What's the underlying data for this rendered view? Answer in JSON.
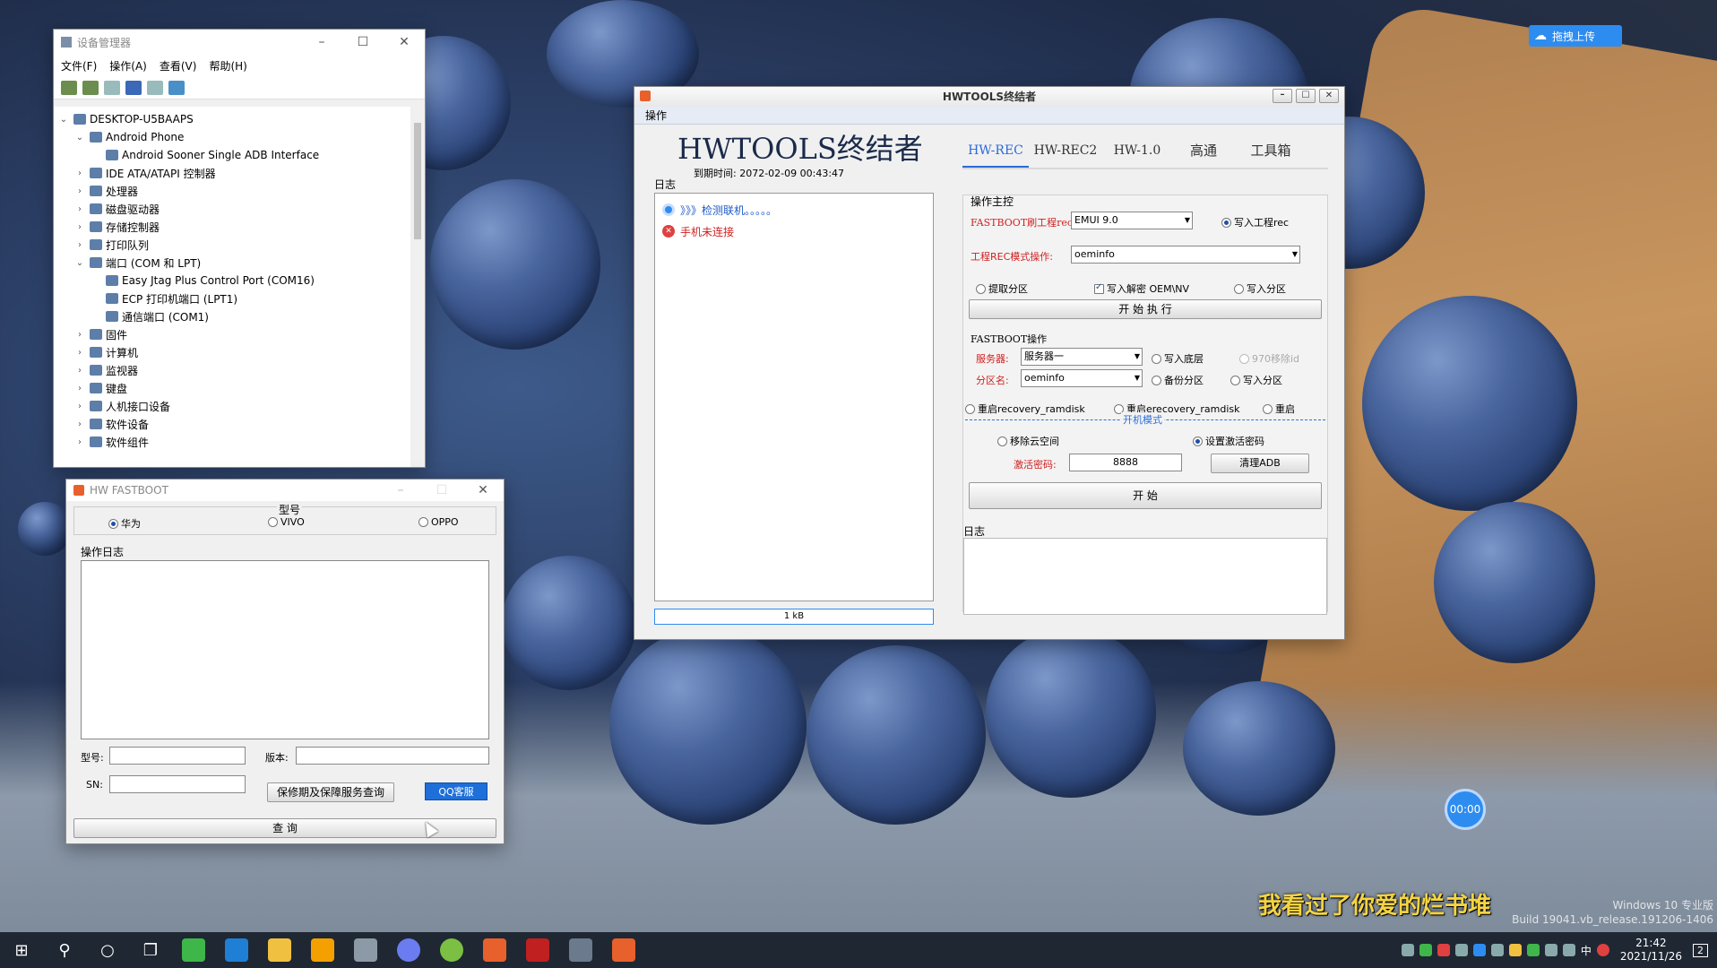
{
  "device_manager": {
    "title": "设备管理器",
    "menu": [
      "文件(F)",
      "操作(A)",
      "查看(V)",
      "帮助(H)"
    ],
    "tree": [
      {
        "label": "DESKTOP-U5BAAPS",
        "level": 0,
        "expanded": true
      },
      {
        "label": "Android Phone",
        "level": 1,
        "expanded": true
      },
      {
        "label": "Android Sooner Single ADB Interface",
        "level": 2
      },
      {
        "label": "IDE ATA/ATAPI 控制器",
        "level": 1
      },
      {
        "label": "处理器",
        "level": 1
      },
      {
        "label": "磁盘驱动器",
        "level": 1
      },
      {
        "label": "存储控制器",
        "level": 1
      },
      {
        "label": "打印队列",
        "level": 1
      },
      {
        "label": "端口 (COM 和 LPT)",
        "level": 1,
        "expanded": true
      },
      {
        "label": "Easy Jtag Plus Control Port (COM16)",
        "level": 2
      },
      {
        "label": "ECP 打印机端口 (LPT1)",
        "level": 2
      },
      {
        "label": "通信端口 (COM1)",
        "level": 2
      },
      {
        "label": "固件",
        "level": 1
      },
      {
        "label": "计算机",
        "level": 1
      },
      {
        "label": "监视器",
        "level": 1
      },
      {
        "label": "键盘",
        "level": 1
      },
      {
        "label": "人机接口设备",
        "level": 1
      },
      {
        "label": "软件设备",
        "level": 1
      },
      {
        "label": "软件组件",
        "level": 1
      }
    ]
  },
  "hw_fastboot": {
    "title": "HW FASTBOOT",
    "model_group": "型号",
    "brands": [
      "华为",
      "VIVO",
      "OPPO"
    ],
    "log_label": "操作日志",
    "model_label": "型号:",
    "version_label": "版本:",
    "sn_label": "SN:",
    "warranty_button": "保修期及保障服务查询",
    "qq_button": "QQ客服",
    "query_button": "查  询"
  },
  "hwtools": {
    "title": "HWTOOLS终结者",
    "menu": "操作",
    "logo": "HWTOOLS终结者",
    "expiry": "到期时间: 2072-02-09 00:43:47",
    "tabs": [
      "HW-REC",
      "HW-REC2",
      "HW-1.0",
      "高通",
      "工具箱"
    ],
    "log_label": "日志",
    "log_entries": [
      {
        "text": "》》》检测联机。。。。。",
        "kind": "info"
      },
      {
        "text": "手机未连接",
        "kind": "error"
      }
    ],
    "progress_text": "1  kB",
    "main_group": "操作主控",
    "fastboot_rec_label": "FASTBOOT刷工程rec:",
    "fastboot_rec_value": "EMUI 9.0",
    "write_rec": "写入工程rec",
    "rec_mode_label": "工程REC模式操作:",
    "rec_mode_value": "oeminfo",
    "extract_partition": "提取分区",
    "write_unlock": "写入解密 OEM\\NV",
    "write_partition": "写入分区",
    "start_execute": "开 始 执 行",
    "fastboot_group": "FASTBOOT操作",
    "server_label": "服务器:",
    "server_value": "服务器一",
    "write_base": "写入底层",
    "remove_970": "970移除id",
    "partition_label": "分区名:",
    "partition_value": "oeminfo",
    "backup_partition": "备份分区",
    "write_partition2": "写入分区",
    "reboot_recovery1": "重启recovery_ramdisk",
    "reboot_recovery2": "重启erecovery_ramdisk",
    "reboot": "重启",
    "boot_mode": "开机模式",
    "remove_cloud": "移除云空间",
    "set_password": "设置激活密码",
    "password_label": "激活密码:",
    "password_value": "8888",
    "clear_adb": "清理ADB",
    "start": "开  始",
    "log2_label": "日志"
  },
  "overlay": {
    "upload_button": "拖拽上传",
    "timer": "00:00",
    "subtitle": "我看过了你爱的烂书堆",
    "watermark_line1": "Windows 10 专业版",
    "watermark_line2": "Build 19041.vb_release.191206-1406"
  },
  "taskbar": {
    "time": "21:42",
    "date": "2021/11/26",
    "ime": "中",
    "notifications": "2"
  }
}
